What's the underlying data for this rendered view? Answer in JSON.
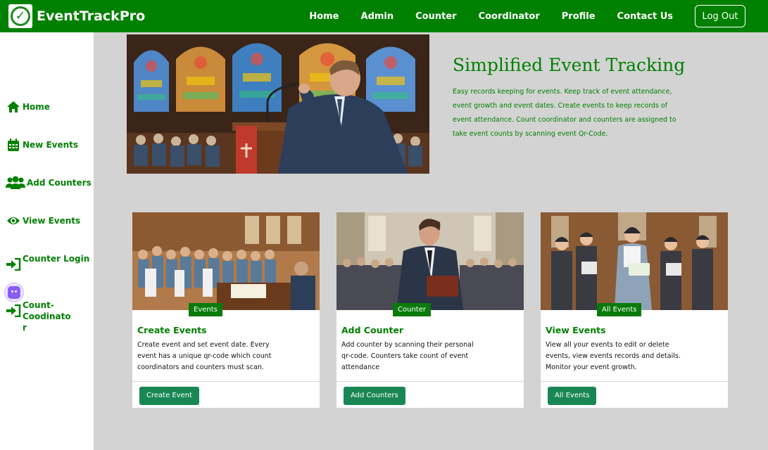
{
  "navbar": {
    "brand": "EventTrackPro",
    "links": [
      "Home",
      "Admin",
      "Counter",
      "Coordinator",
      "Profile",
      "Contact Us"
    ],
    "logout": "Log Out"
  },
  "sidebar": {
    "items": [
      {
        "label": "Home",
        "icon": "home-icon"
      },
      {
        "label": "New Events",
        "icon": "calendar-icon"
      },
      {
        "label": "Add Counters",
        "icon": "users-icon"
      },
      {
        "label": "View Events",
        "icon": "eye-icon"
      },
      {
        "label": "Counter Login",
        "icon": "sign-in-icon"
      },
      {
        "label": "Count-Coodinator",
        "icon": "sign-in-icon"
      }
    ]
  },
  "hero": {
    "title": "Simplified Event Tracking",
    "description": "Easy records keeping for events. Keep track of event attendance, event growth and event dates. Create events to keep records of event attendance. Count coordinator and counters are assigned to take event counts by scanning event Qr-Code."
  },
  "cards": [
    {
      "badge": "Events",
      "title": "Create Events",
      "text": "Create event and set event date. Every event has a unique qr-code which count coordinators and counters must scan.",
      "button": "Create Event"
    },
    {
      "badge": "Counter",
      "title": "Add Counter",
      "text": "Add counter by scanning their personal qr-code. Counters take count of event attendance",
      "button": "Add Counters"
    },
    {
      "badge": "All Events",
      "title": "View Events",
      "text": "View all your events to edit or delete events, view events records and details. Monitor your event growth.",
      "button": "All Events"
    }
  ],
  "colors": {
    "brand": "#008000",
    "button": "#198754",
    "background": "#d3d3d3"
  }
}
